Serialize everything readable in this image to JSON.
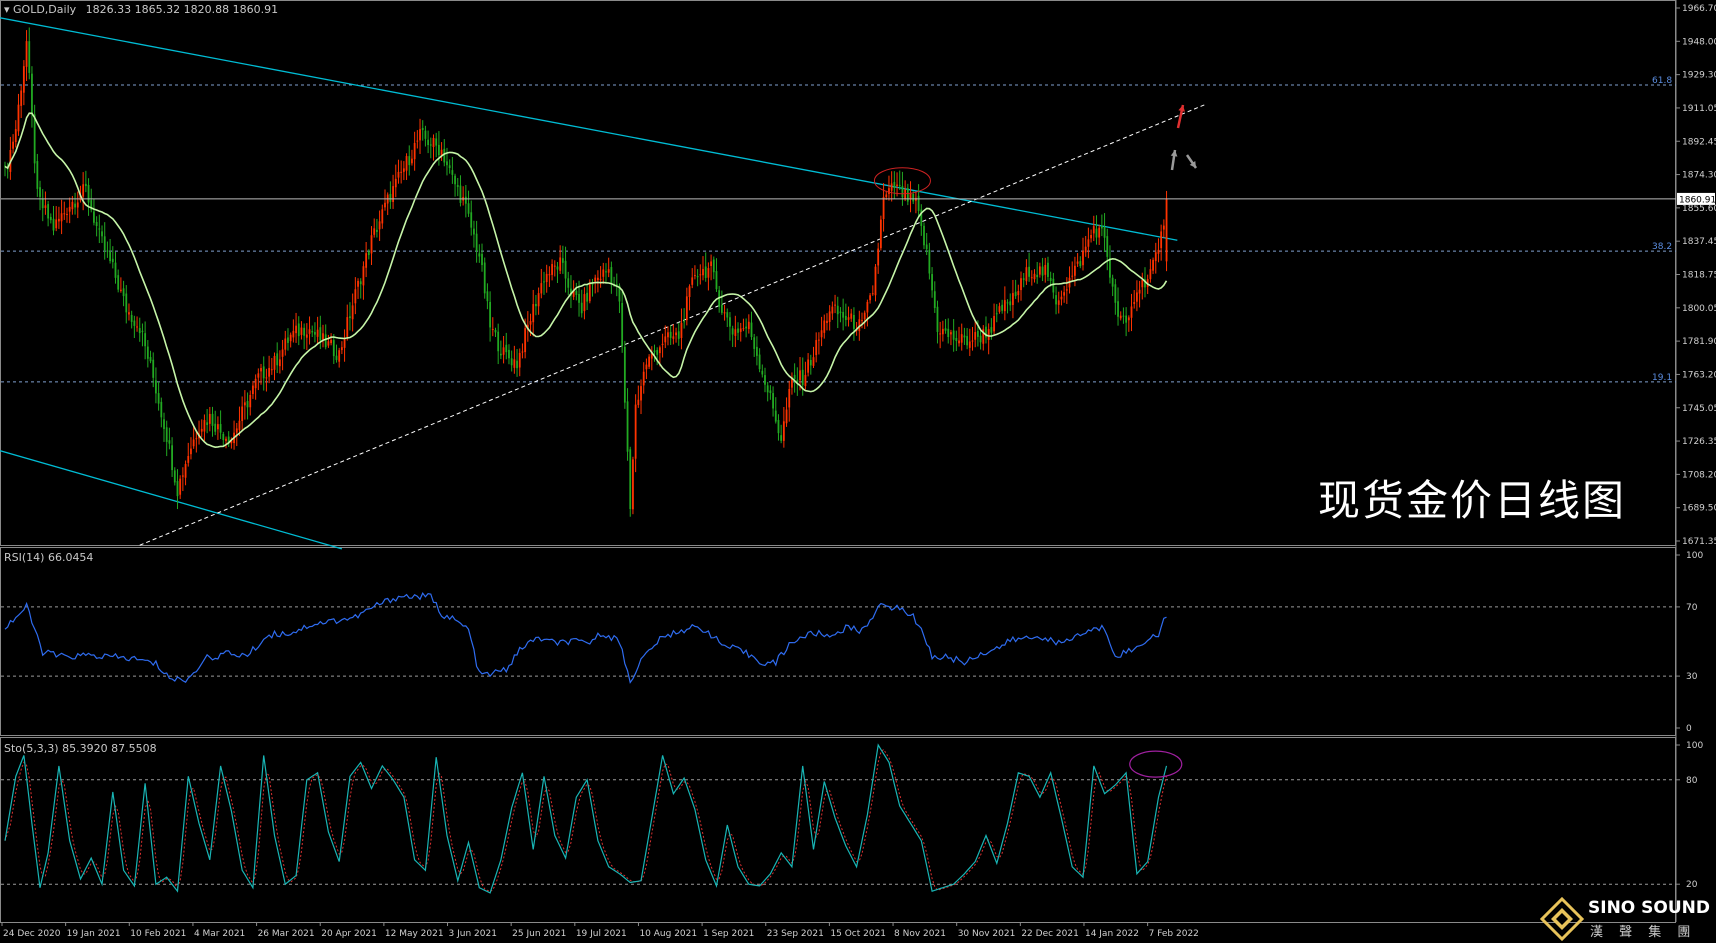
{
  "symbol_header": {
    "arrow": "▾",
    "symbol": "GOLD,Daily",
    "ohlc": "1826.33 1865.32 1820.88 1860.91"
  },
  "watermark_title": "现货金价日线图",
  "logo": {
    "name": "SINO SOUND",
    "sub": "漢 聲 集 團"
  },
  "colors": {
    "background": "#000000",
    "bull": "#ff3300",
    "bear": "#22aa22",
    "ma": "#c6f5a8",
    "channel": "#00bcd4",
    "rsi": "#2f6cf0",
    "stoch_main": "#18b5b5",
    "stoch_signal": "#d93030",
    "grid_dashed": "#7f9fd0"
  },
  "chart_data": [
    {
      "type": "candlestick",
      "panel": "price",
      "title": "GOLD,Daily",
      "y_ticks": [
        "1966.70",
        "1948.00",
        "1929.30",
        "1911.05",
        "1892.45",
        "1874.30",
        "1855.60",
        "1837.45",
        "1818.75",
        "1800.05",
        "1781.90",
        "1763.20",
        "1745.05",
        "1726.35",
        "1708.20",
        "1689.50",
        "1671.35"
      ],
      "ylim": [
        1671.35,
        1966.7
      ],
      "current_price": "1860.91",
      "fib_levels": [
        {
          "label": "61.8",
          "value": 1924.0
        },
        {
          "label": "38.2",
          "value": 1832.0
        },
        {
          "label": "19.1",
          "value": 1759.5
        }
      ],
      "x_tick_labels": [
        "24 Dec 2020",
        "19 Jan 2021",
        "10 Feb 2021",
        "4 Mar 2021",
        "26 Mar 2021",
        "20 Apr 2021",
        "12 May 2021",
        "3 Jun 2021",
        "25 Jun 2021",
        "19 Jul 2021",
        "10 Aug 2021",
        "1 Sep 2021",
        "23 Sep 2021",
        "15 Oct 2021",
        "8 Nov 2021",
        "30 Nov 2021",
        "22 Dec 2021",
        "14 Jan 2022",
        "7 Feb 2022"
      ],
      "close_anchors": [
        [
          0,
          1875
        ],
        [
          4,
          1900
        ],
        [
          8,
          1948
        ],
        [
          12,
          1862
        ],
        [
          18,
          1845
        ],
        [
          24,
          1858
        ],
        [
          30,
          1866
        ],
        [
          35,
          1840
        ],
        [
          40,
          1822
        ],
        [
          45,
          1800
        ],
        [
          50,
          1790
        ],
        [
          55,
          1762
        ],
        [
          60,
          1730
        ],
        [
          64,
          1700
        ],
        [
          68,
          1720
        ],
        [
          72,
          1735
        ],
        [
          76,
          1740
        ],
        [
          80,
          1732
        ],
        [
          84,
          1728
        ],
        [
          88,
          1742
        ],
        [
          94,
          1762
        ],
        [
          100,
          1770
        ],
        [
          106,
          1785
        ],
        [
          112,
          1790
        ],
        [
          118,
          1782
        ],
        [
          124,
          1775
        ],
        [
          130,
          1808
        ],
        [
          136,
          1838
        ],
        [
          142,
          1860
        ],
        [
          148,
          1878
        ],
        [
          154,
          1896
        ],
        [
          158,
          1892
        ],
        [
          162,
          1888
        ],
        [
          166,
          1872
        ],
        [
          170,
          1860
        ],
        [
          176,
          1830
        ],
        [
          180,
          1790
        ],
        [
          185,
          1775
        ],
        [
          190,
          1770
        ],
        [
          196,
          1800
        ],
        [
          200,
          1818
        ],
        [
          206,
          1825
        ],
        [
          210,
          1810
        ],
        [
          214,
          1800
        ],
        [
          218,
          1815
        ],
        [
          224,
          1822
        ],
        [
          228,
          1805
        ],
        [
          232,
          1690
        ],
        [
          234,
          1746
        ],
        [
          238,
          1770
        ],
        [
          244,
          1782
        ],
        [
          250,
          1785
        ],
        [
          256,
          1820
        ],
        [
          262,
          1822
        ],
        [
          266,
          1800
        ],
        [
          270,
          1788
        ],
        [
          276,
          1790
        ],
        [
          280,
          1770
        ],
        [
          284,
          1750
        ],
        [
          288,
          1728
        ],
        [
          292,
          1760
        ],
        [
          296,
          1762
        ],
        [
          300,
          1775
        ],
        [
          306,
          1800
        ],
        [
          312,
          1795
        ],
        [
          318,
          1790
        ],
        [
          322,
          1810
        ],
        [
          326,
          1860
        ],
        [
          330,
          1868
        ],
        [
          334,
          1862
        ],
        [
          338,
          1858
        ],
        [
          342,
          1830
        ],
        [
          346,
          1790
        ],
        [
          350,
          1785
        ],
        [
          356,
          1782
        ],
        [
          362,
          1785
        ],
        [
          366,
          1790
        ],
        [
          370,
          1800
        ],
        [
          374,
          1805
        ],
        [
          380,
          1822
        ],
        [
          386,
          1820
        ],
        [
          390,
          1805
        ],
        [
          396,
          1818
        ],
        [
          400,
          1830
        ],
        [
          404,
          1845
        ],
        [
          408,
          1840
        ],
        [
          412,
          1800
        ],
        [
          416,
          1790
        ],
        [
          420,
          1810
        ],
        [
          424,
          1818
        ],
        [
          428,
          1830
        ],
        [
          431,
          1860
        ]
      ],
      "ma_period": 20,
      "series": [
        {
          "kind": "trendline",
          "values": [
            [
              -8,
              1963
            ],
            [
              435,
              1838
            ]
          ]
        },
        {
          "kind": "trendline",
          "values": [
            [
              -8,
              1724
            ],
            [
              125,
              1667
            ]
          ]
        },
        {
          "kind": "trendline",
          "style": "dashed",
          "values": [
            [
              50,
              1669
            ],
            [
              445,
              1913
            ]
          ]
        }
      ],
      "annotations": [
        "arrow-up-red",
        "arrow-up-gray",
        "arrow-down-gray",
        "ellipse-nov-top"
      ]
    },
    {
      "type": "line",
      "panel": "rsi",
      "title": "RSI(14) 66.0454",
      "y_ticks": [
        "100",
        "70",
        "30",
        "0"
      ],
      "ylim": [
        0,
        100
      ],
      "levels": [
        70,
        30
      ],
      "series": [
        {
          "name": "RSI(14)",
          "values": [
            [
              0,
              58
            ],
            [
              8,
              70
            ],
            [
              14,
              44
            ],
            [
              22,
              41
            ],
            [
              30,
              42
            ],
            [
              40,
              41
            ],
            [
              48,
              40
            ],
            [
              56,
              37
            ],
            [
              62,
              28
            ],
            [
              68,
              28
            ],
            [
              74,
              40
            ],
            [
              82,
              43
            ],
            [
              90,
              42
            ],
            [
              98,
              54
            ],
            [
              106,
              55
            ],
            [
              114,
              60
            ],
            [
              122,
              62
            ],
            [
              130,
              64
            ],
            [
              138,
              71
            ],
            [
              146,
              76
            ],
            [
              152,
              76
            ],
            [
              158,
              76
            ],
            [
              162,
              66
            ],
            [
              166,
              63
            ],
            [
              172,
              57
            ],
            [
              176,
              31
            ],
            [
              180,
              31
            ],
            [
              186,
              34
            ],
            [
              192,
              47
            ],
            [
              198,
              52
            ],
            [
              204,
              49
            ],
            [
              210,
              50
            ],
            [
              216,
              49
            ],
            [
              222,
              55
            ],
            [
              228,
              50
            ],
            [
              232,
              27
            ],
            [
              236,
              39
            ],
            [
              242,
              50
            ],
            [
              248,
              55
            ],
            [
              254,
              58
            ],
            [
              260,
              57
            ],
            [
              266,
              48
            ],
            [
              272,
              45
            ],
            [
              278,
              41
            ],
            [
              282,
              37
            ],
            [
              286,
              38
            ],
            [
              292,
              50
            ],
            [
              300,
              55
            ],
            [
              306,
              53
            ],
            [
              312,
              58
            ],
            [
              318,
              56
            ],
            [
              324,
              70
            ],
            [
              330,
              70
            ],
            [
              336,
              66
            ],
            [
              340,
              58
            ],
            [
              344,
              41
            ],
            [
              350,
              41
            ],
            [
              356,
              38
            ],
            [
              362,
              43
            ],
            [
              368,
              46
            ],
            [
              374,
              51
            ],
            [
              380,
              52
            ],
            [
              386,
              53
            ],
            [
              390,
              48
            ],
            [
              396,
              52
            ],
            [
              402,
              56
            ],
            [
              408,
              58
            ],
            [
              412,
              42
            ],
            [
              416,
              44
            ],
            [
              420,
              46
            ],
            [
              424,
              52
            ],
            [
              428,
              54
            ],
            [
              431,
              66
            ]
          ]
        }
      ]
    },
    {
      "type": "line",
      "panel": "stochastic",
      "title": "Sto(5,3,3) 85.3920 87.5508",
      "y_ticks": [
        "100",
        "80",
        "20"
      ],
      "ylim": [
        0,
        100
      ],
      "levels": [
        80,
        20
      ],
      "series": [
        {
          "name": "Sto %K",
          "values": [
            [
              0,
              45
            ],
            [
              4,
              82
            ],
            [
              7,
              94
            ],
            [
              10,
              55
            ],
            [
              13,
              18
            ],
            [
              16,
              38
            ],
            [
              20,
              88
            ],
            [
              24,
              45
            ],
            [
              28,
              23
            ],
            [
              32,
              35
            ],
            [
              36,
              20
            ],
            [
              40,
              73
            ],
            [
              44,
              28
            ],
            [
              48,
              19
            ],
            [
              52,
              78
            ],
            [
              56,
              20
            ],
            [
              60,
              24
            ],
            [
              64,
              16
            ],
            [
              68,
              82
            ],
            [
              72,
              55
            ],
            [
              76,
              34
            ],
            [
              80,
              88
            ],
            [
              84,
              62
            ],
            [
              88,
              28
            ],
            [
              92,
              18
            ],
            [
              96,
              94
            ],
            [
              100,
              48
            ],
            [
              104,
              20
            ],
            [
              108,
              25
            ],
            [
              112,
              80
            ],
            [
              116,
              84
            ],
            [
              120,
              50
            ],
            [
              124,
              33
            ],
            [
              128,
              82
            ],
            [
              132,
              90
            ],
            [
              136,
              75
            ],
            [
              140,
              88
            ],
            [
              144,
              80
            ],
            [
              148,
              70
            ],
            [
              152,
              34
            ],
            [
              156,
              28
            ],
            [
              160,
              93
            ],
            [
              164,
              48
            ],
            [
              168,
              22
            ],
            [
              172,
              44
            ],
            [
              176,
              18
            ],
            [
              180,
              15
            ],
            [
              184,
              34
            ],
            [
              188,
              64
            ],
            [
              192,
              84
            ],
            [
              196,
              40
            ],
            [
              200,
              82
            ],
            [
              204,
              48
            ],
            [
              208,
              35
            ],
            [
              212,
              70
            ],
            [
              216,
              80
            ],
            [
              220,
              45
            ],
            [
              224,
              30
            ],
            [
              228,
              26
            ],
            [
              232,
              21
            ],
            [
              236,
              22
            ],
            [
              240,
              58
            ],
            [
              244,
              94
            ],
            [
              248,
              72
            ],
            [
              252,
              81
            ],
            [
              256,
              63
            ],
            [
              260,
              34
            ],
            [
              264,
              19
            ],
            [
              268,
              54
            ],
            [
              272,
              30
            ],
            [
              276,
              20
            ],
            [
              280,
              19
            ],
            [
              284,
              26
            ],
            [
              288,
              38
            ],
            [
              292,
              30
            ],
            [
              296,
              88
            ],
            [
              300,
              40
            ],
            [
              304,
              79
            ],
            [
              308,
              58
            ],
            [
              312,
              42
            ],
            [
              316,
              30
            ],
            [
              320,
              60
            ],
            [
              324,
              100
            ],
            [
              328,
              90
            ],
            [
              332,
              65
            ],
            [
              336,
              55
            ],
            [
              340,
              45
            ],
            [
              344,
              16
            ],
            [
              348,
              18
            ],
            [
              352,
              20
            ],
            [
              356,
              26
            ],
            [
              360,
              33
            ],
            [
              364,
              48
            ],
            [
              368,
              32
            ],
            [
              372,
              55
            ],
            [
              376,
              84
            ],
            [
              380,
              82
            ],
            [
              384,
              70
            ],
            [
              388,
              84
            ],
            [
              392,
              58
            ],
            [
              396,
              30
            ],
            [
              400,
              24
            ],
            [
              404,
              88
            ],
            [
              408,
              72
            ],
            [
              412,
              77
            ],
            [
              416,
              84
            ],
            [
              420,
              26
            ],
            [
              424,
              33
            ],
            [
              428,
              70
            ],
            [
              431,
              88
            ]
          ]
        },
        {
          "name": "Sto %D",
          "smoothing": 3
        }
      ]
    }
  ]
}
